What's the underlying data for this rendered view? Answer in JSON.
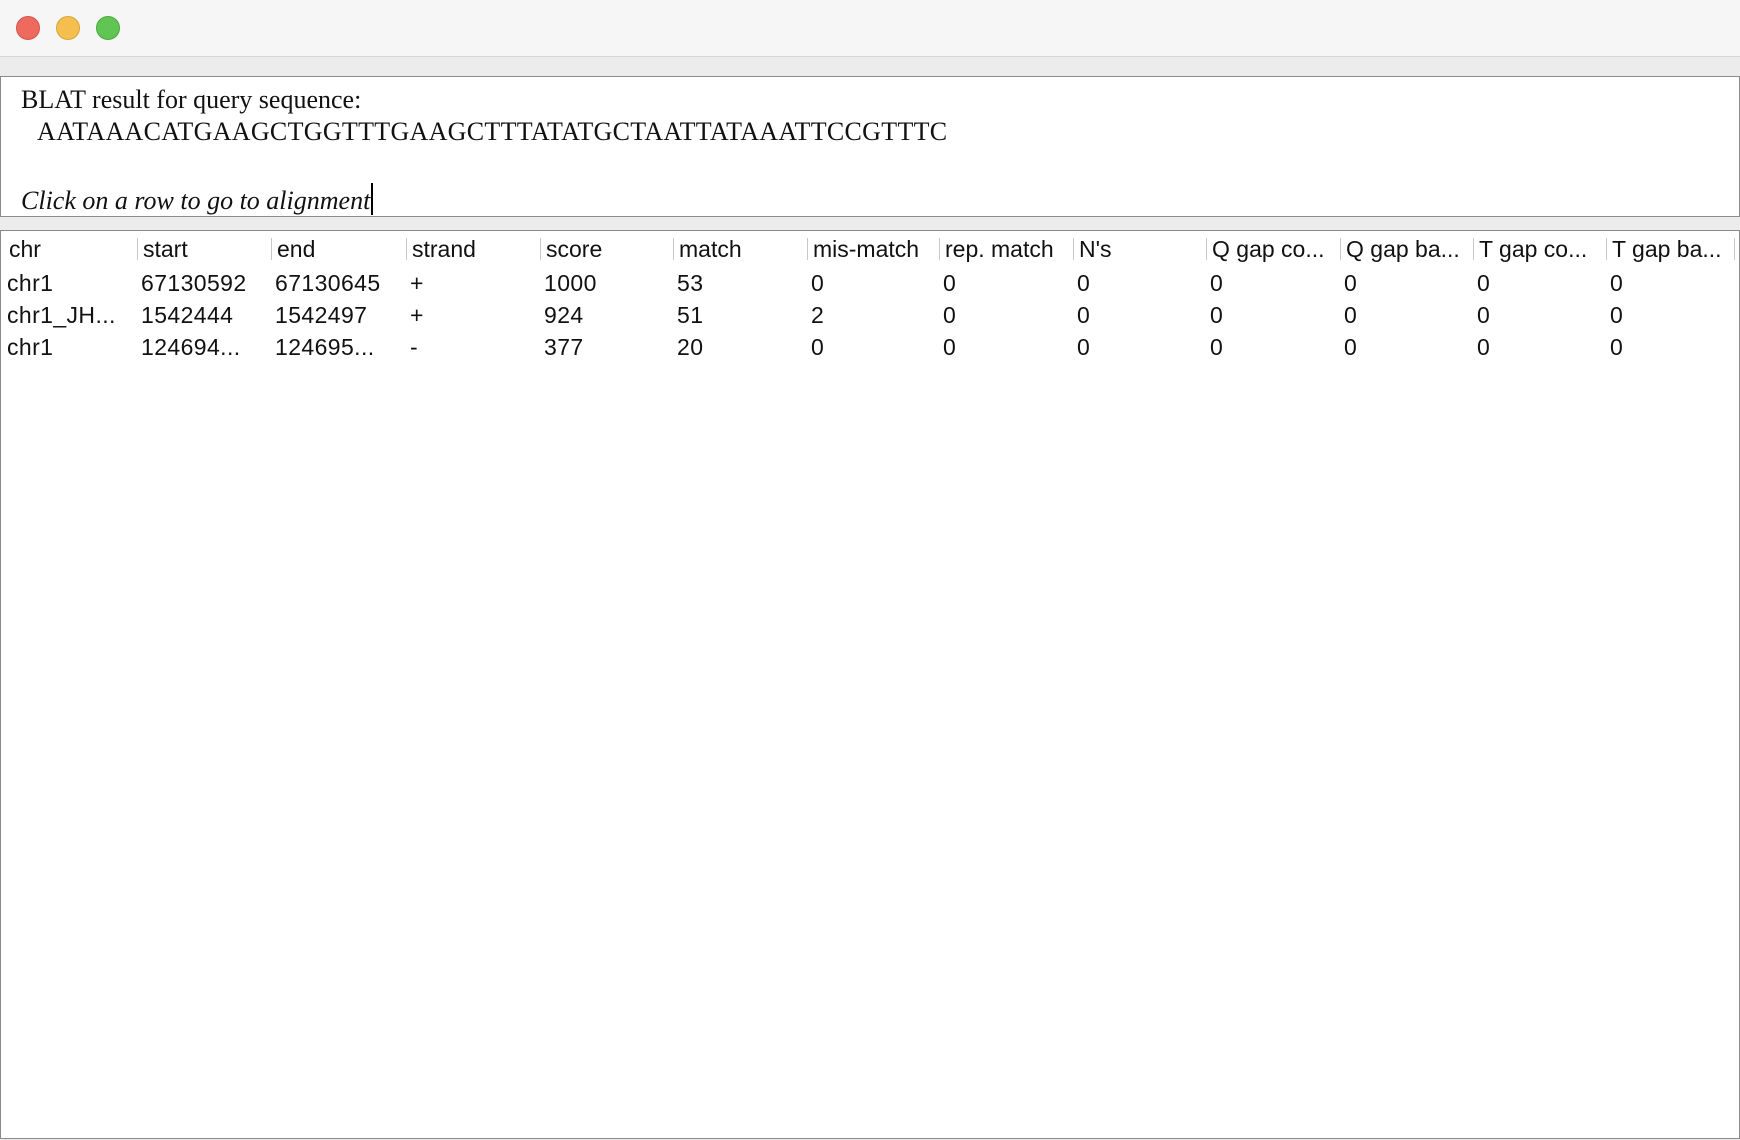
{
  "window": {
    "buttons": [
      "close",
      "minimize",
      "zoom"
    ]
  },
  "header": {
    "title": "BLAT result for query sequence:",
    "sequence": "AATAAACATGAAGCTGGTTTGAAGCTTTATATGCTAATTATAAATTCCGTTTC",
    "hint": "Click on a row to go to alignment"
  },
  "table": {
    "columns": [
      "chr",
      "start",
      "end",
      "strand",
      "score",
      "match",
      "mis-match",
      "rep. match",
      "N's",
      "Q gap co...",
      "Q gap ba...",
      "T gap co...",
      "T gap ba..."
    ],
    "rows": [
      [
        "chr1",
        "67130592",
        "67130645",
        "+",
        "1000",
        "53",
        "0",
        "0",
        "0",
        "0",
        "0",
        "0",
        "0"
      ],
      [
        "chr1_JH...",
        "1542444",
        "1542497",
        "+",
        "924",
        "51",
        "2",
        "0",
        "0",
        "0",
        "0",
        "0",
        "0"
      ],
      [
        "chr1",
        "124694...",
        "124695...",
        "-",
        "377",
        "20",
        "0",
        "0",
        "0",
        "0",
        "0",
        "0",
        "0"
      ]
    ]
  }
}
